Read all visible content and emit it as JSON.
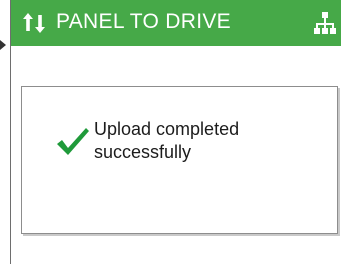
{
  "header": {
    "title": "PANEL TO DRIVE",
    "left_icon": "transfer-arrows-icon",
    "right_icon": "hierarchy-icon",
    "background": "#46a948",
    "text_color": "#ffffff"
  },
  "dialog": {
    "icon": "checkmark-icon",
    "icon_color": "#1f9a3a",
    "message": "Upload completed successfully"
  }
}
